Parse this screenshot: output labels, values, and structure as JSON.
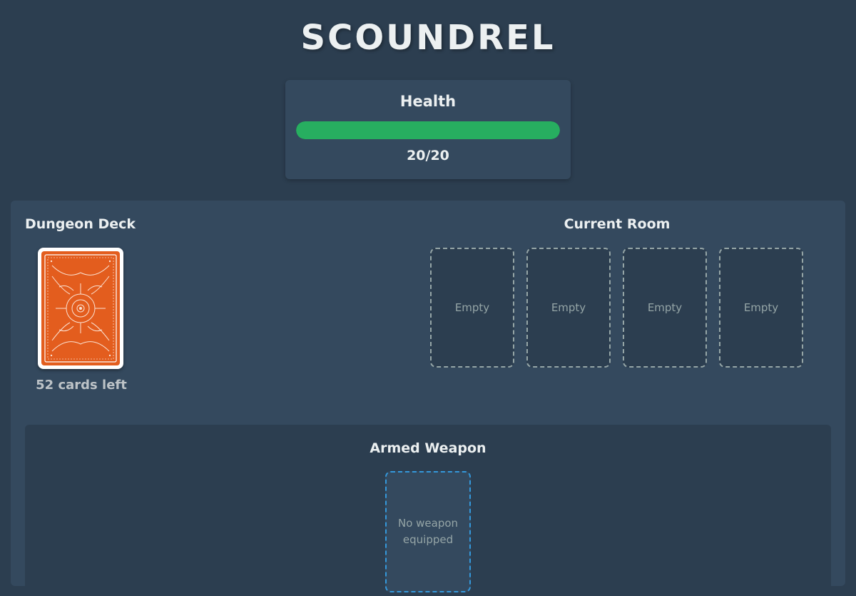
{
  "app": {
    "title": "SCOUNDREL"
  },
  "health": {
    "label": "Health",
    "current": 20,
    "max": 20,
    "text": "20/20",
    "fill_fraction": 1.0,
    "color": "#27ae60"
  },
  "deck": {
    "heading": "Dungeon Deck",
    "count_text": "52 cards left",
    "card_back_color": "#e35d1e"
  },
  "room": {
    "heading": "Current Room",
    "slots": [
      {
        "label": "Empty"
      },
      {
        "label": "Empty"
      },
      {
        "label": "Empty"
      },
      {
        "label": "Empty"
      }
    ]
  },
  "weapon": {
    "heading": "Armed Weapon",
    "placeholder": "No weapon equipped"
  },
  "colors": {
    "background": "#2c3e50",
    "panel": "#34495e",
    "accent": "#3498db"
  }
}
